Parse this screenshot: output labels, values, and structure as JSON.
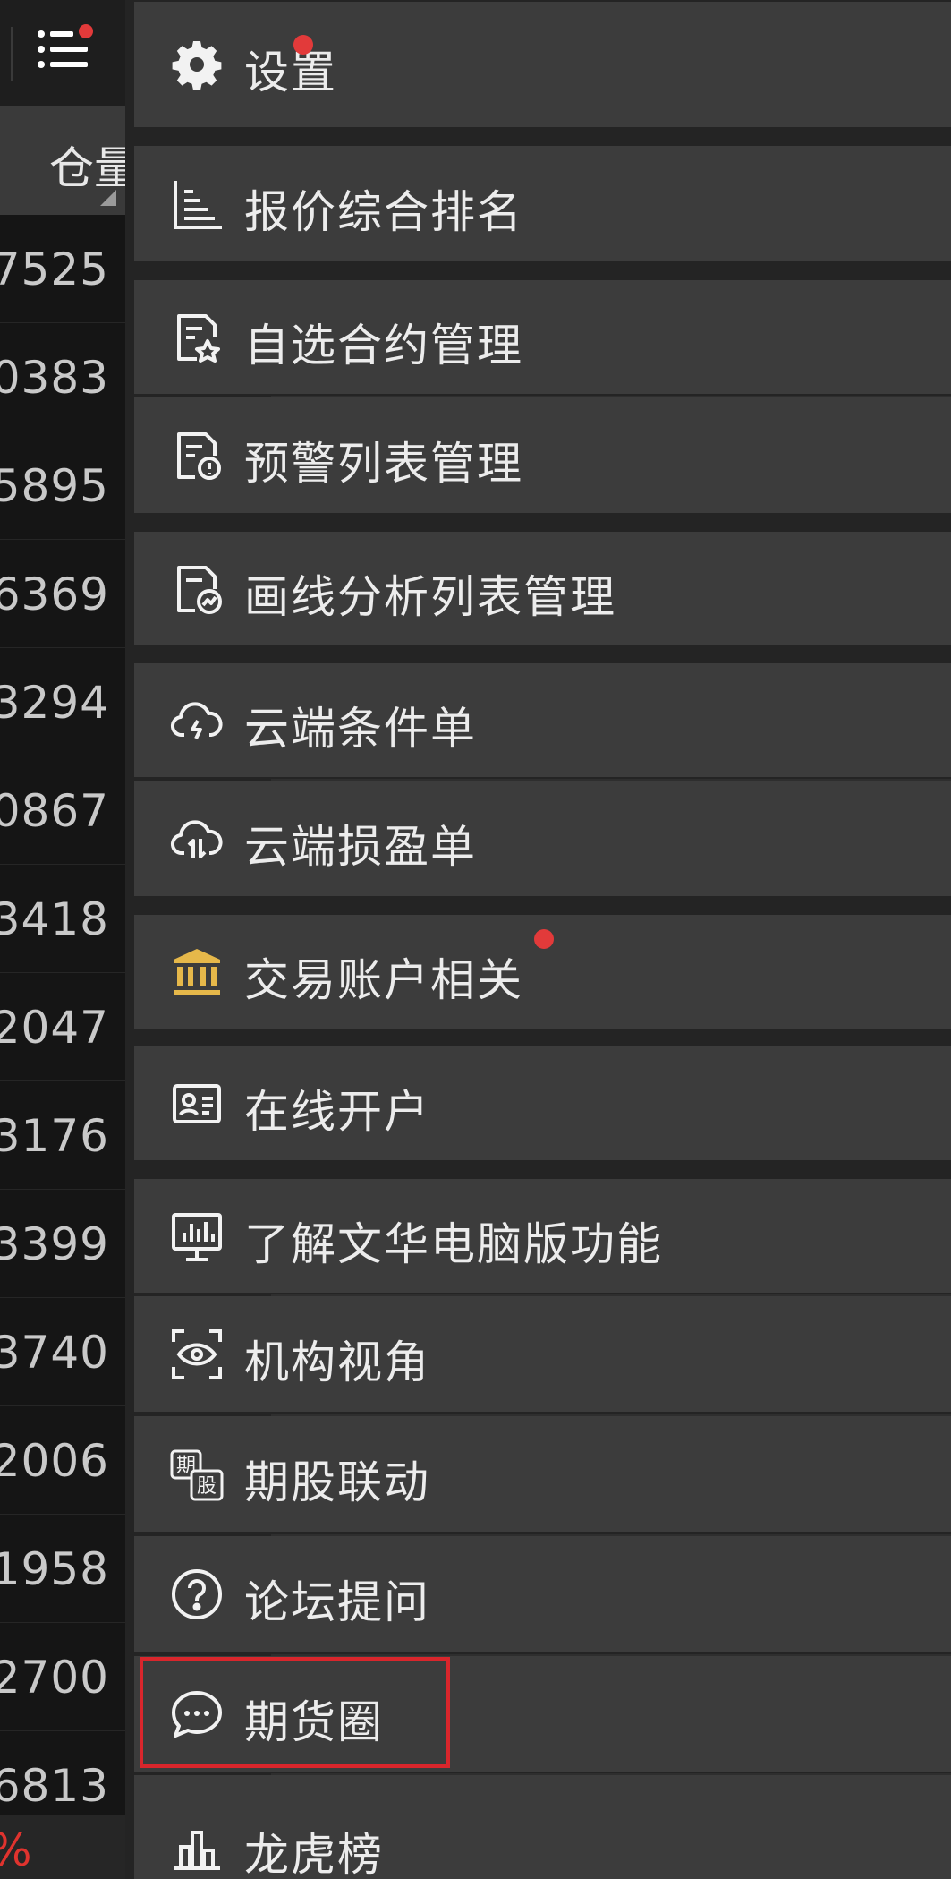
{
  "left_panel": {
    "column_header": "仓量",
    "values": [
      "7525",
      "0383",
      "5895",
      "6369",
      "3294",
      "0867",
      "3418",
      "2047",
      "3176",
      "3399",
      "3740",
      "2006",
      "1958",
      "2700",
      "6813"
    ],
    "bottom_text": "%"
  },
  "menu": {
    "items": [
      {
        "label": "设置",
        "icon": "gear-icon",
        "badge": true
      },
      {
        "label": "报价综合排名",
        "icon": "ranking-list-icon"
      },
      {
        "label": "自选合约管理",
        "icon": "watchlist-document-icon"
      },
      {
        "label": "预警列表管理",
        "icon": "alert-document-icon"
      },
      {
        "label": "画线分析列表管理",
        "icon": "chart-document-icon"
      },
      {
        "label": "云端条件单",
        "icon": "cloud-lightning-icon"
      },
      {
        "label": "云端损盈单",
        "icon": "cloud-transfer-icon"
      },
      {
        "label": "交易账户相关",
        "icon": "bank-icon",
        "badge": true
      },
      {
        "label": "在线开户",
        "icon": "id-card-icon"
      },
      {
        "label": "了解文华电脑版功能",
        "icon": "monitor-chart-icon"
      },
      {
        "label": "机构视角",
        "icon": "eye-scan-icon"
      },
      {
        "label": "期股联动",
        "icon": "futures-stocks-icon",
        "icon_chars": [
          "期",
          "股"
        ]
      },
      {
        "label": "论坛提问",
        "icon": "question-icon"
      },
      {
        "label": "期货圈",
        "icon": "chat-bubble-icon",
        "highlighted": true
      },
      {
        "label": "龙虎榜",
        "icon": "bar-chart-icon"
      }
    ]
  },
  "colors": {
    "badge": "#e23a3a",
    "highlight": "#d9262c",
    "bank_icon": "#e6b84a",
    "negative": "#e0332e"
  }
}
